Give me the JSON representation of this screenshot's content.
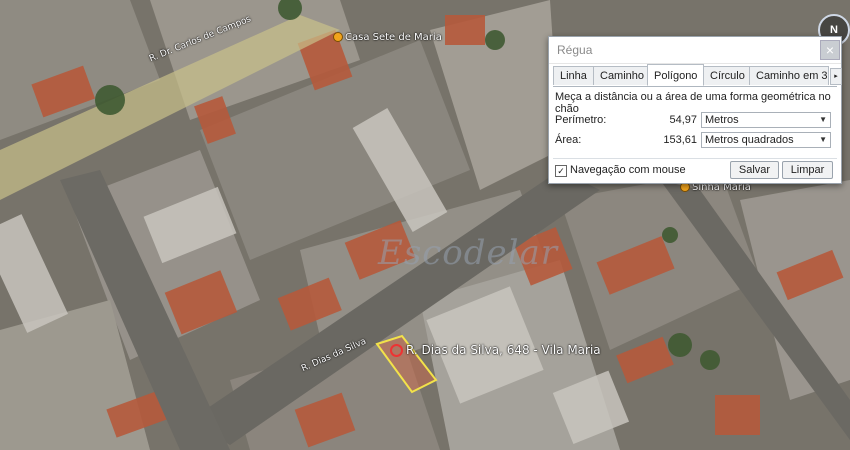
{
  "map": {
    "street_top": "R. Dr. Carlos de Campos",
    "poi_top": "Casa Sete de Maria",
    "poi_right": "Sinhá Maria",
    "street_diag": "R. Dias da Silva",
    "address": "R. Dias da Silva, 648 - Vila Maria",
    "watermark": "Escodelar",
    "compass": "N"
  },
  "ruler": {
    "title": "Régua",
    "close": "×",
    "tabs": [
      "Linha",
      "Caminho",
      "Polígono",
      "Círculo",
      "Caminho em 3D"
    ],
    "active_tab": "Polígono",
    "tab_more": "▸",
    "description": "Meça a distância ou a área de uma forma geométrica no chão",
    "perimeter": {
      "label": "Perímetro:",
      "value": "54,97",
      "unit": "Metros"
    },
    "area": {
      "label": "Área:",
      "value": "153,61",
      "unit": "Metros quadrados"
    },
    "mouse_nav": {
      "label": "Navegação com mouse",
      "checked": true,
      "mark": "✓"
    },
    "save": "Salvar",
    "clear": "Limpar"
  },
  "colors": {
    "polygon": "#f2e24a",
    "pin": "#f2a41c"
  }
}
